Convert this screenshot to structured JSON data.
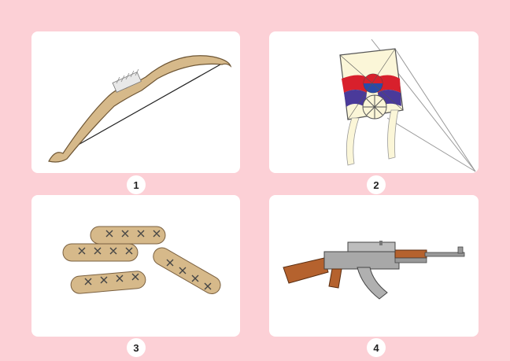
{
  "cards": [
    {
      "number": "1",
      "icon": "bow-icon"
    },
    {
      "number": "2",
      "icon": "kite-icon"
    },
    {
      "number": "3",
      "icon": "yut-sticks-icon"
    },
    {
      "number": "4",
      "icon": "rifle-icon"
    }
  ],
  "colors": {
    "background": "#fcd0d6",
    "card": "#ffffff",
    "wood": "#d6b98a",
    "kite_red": "#d8202c",
    "kite_blue": "#4a3a9a",
    "kite_paper": "#fbf6d8",
    "rifle_wood": "#b5622e",
    "rifle_metal": "#9a9a9a"
  }
}
